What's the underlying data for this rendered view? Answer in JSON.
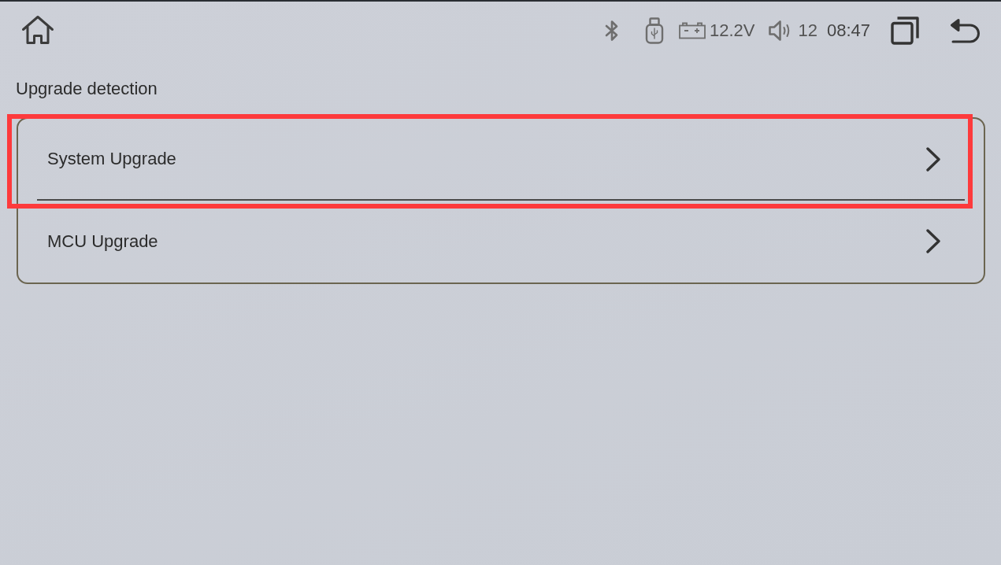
{
  "status_bar": {
    "battery_voltage": "12.2V",
    "volume": "12",
    "time": "08:47"
  },
  "section_title": "Upgrade detection",
  "items": [
    {
      "label": "System Upgrade",
      "highlighted": true
    },
    {
      "label": "MCU Upgrade",
      "highlighted": false
    }
  ]
}
